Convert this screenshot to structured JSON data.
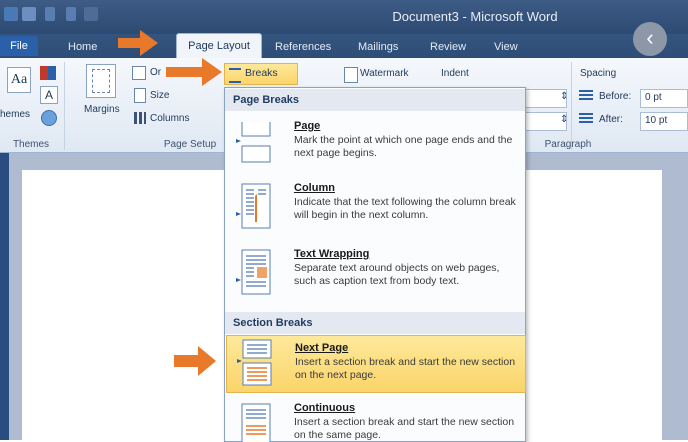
{
  "window": {
    "title": "Document3 - Microsoft Word"
  },
  "tabs": [
    {
      "label": "File"
    },
    {
      "label": "Home"
    },
    {
      "label": "Page Layout"
    },
    {
      "label": "References"
    },
    {
      "label": "Mailings"
    },
    {
      "label": "Review"
    },
    {
      "label": "View"
    }
  ],
  "ribbon": {
    "themes": {
      "label": "Themes",
      "partial_text": "hemes",
      "aa": "Aa",
      "a": "A"
    },
    "page_setup": {
      "label": "Page Setup",
      "margins": "Margins",
      "orientation": "Or",
      "size": "Size",
      "columns": "Columns",
      "breaks": "Breaks"
    },
    "watermark": "Watermark",
    "indent": "Indent",
    "spacing": {
      "label": "Spacing",
      "before_label": "Before:",
      "before_value": "0 pt",
      "after_label": "After:",
      "after_value": "10 pt"
    },
    "paragraph_label": "Paragraph"
  },
  "breaks_menu": {
    "page_breaks_header": "Page Breaks",
    "section_breaks_header": "Section Breaks",
    "items": [
      {
        "title": "Page",
        "desc": "Mark the point at which one page ends and the next page begins."
      },
      {
        "title": "Column",
        "desc": "Indicate that the text following the column break will begin in the next column."
      },
      {
        "title": "Text Wrapping",
        "desc": "Separate text around objects on web pages, such as caption text from body text."
      },
      {
        "title": "Next Page",
        "desc": "Insert a section break and start the new section on the next page."
      },
      {
        "title": "Continuous",
        "desc": "Insert a section break and start the new section on the same page."
      }
    ]
  },
  "colors": {
    "accent_arrow": "#e8792a",
    "highlight": "#fbd46a",
    "titlebar": "#2c4a72"
  }
}
